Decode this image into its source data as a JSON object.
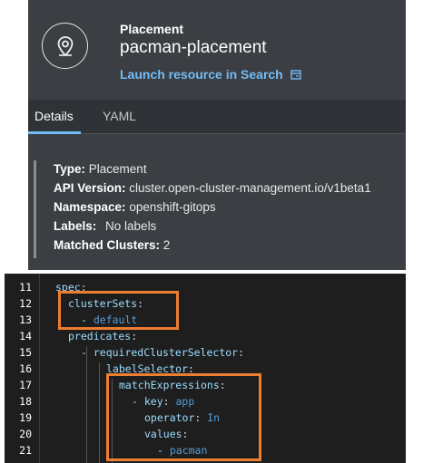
{
  "header": {
    "kind": "Placement",
    "name": "pacman-placement",
    "launch_link": "Launch resource in Search",
    "icon": "map-pin-icon",
    "external_icon": "external-link-icon"
  },
  "tabs": [
    {
      "label": "Details",
      "active": true
    },
    {
      "label": "YAML",
      "active": false
    }
  ],
  "details": {
    "type_label": "Type:",
    "type_value": "Placement",
    "api_label": "API Version:",
    "api_value": "cluster.open-cluster-management.io/v1beta1",
    "ns_label": "Namespace:",
    "ns_value": "openshift-gitops",
    "labels_label": "Labels:",
    "labels_value": "No labels",
    "matched_label": "Matched Clusters:",
    "matched_value": "2"
  },
  "code": {
    "line_numbers": [
      "11",
      "12",
      "13",
      "14",
      "15",
      "16",
      "17",
      "18",
      "19",
      "20",
      "21"
    ],
    "lines": [
      {
        "key": "spec",
        "sep": ":",
        "value": ""
      },
      {
        "key": "clusterSets",
        "sep": ":",
        "value": ""
      },
      {
        "key": "- ",
        "sep": "",
        "value": "default"
      },
      {
        "key": "predicates",
        "sep": ":",
        "value": ""
      },
      {
        "key": "- requiredClusterSelector",
        "sep": ":",
        "value": ""
      },
      {
        "key": "labelSelector",
        "sep": ":",
        "value": ""
      },
      {
        "key": "matchExpressions",
        "sep": ":",
        "value": ""
      },
      {
        "key": "- key",
        "sep": ": ",
        "value": "app"
      },
      {
        "key": "operator",
        "sep": ": ",
        "value": "In"
      },
      {
        "key": "values",
        "sep": ":",
        "value": ""
      },
      {
        "key": "- ",
        "sep": "",
        "value": "pacman"
      }
    ]
  },
  "colors": {
    "accent": "#73bcf7",
    "highlight": "#ed7d31"
  }
}
